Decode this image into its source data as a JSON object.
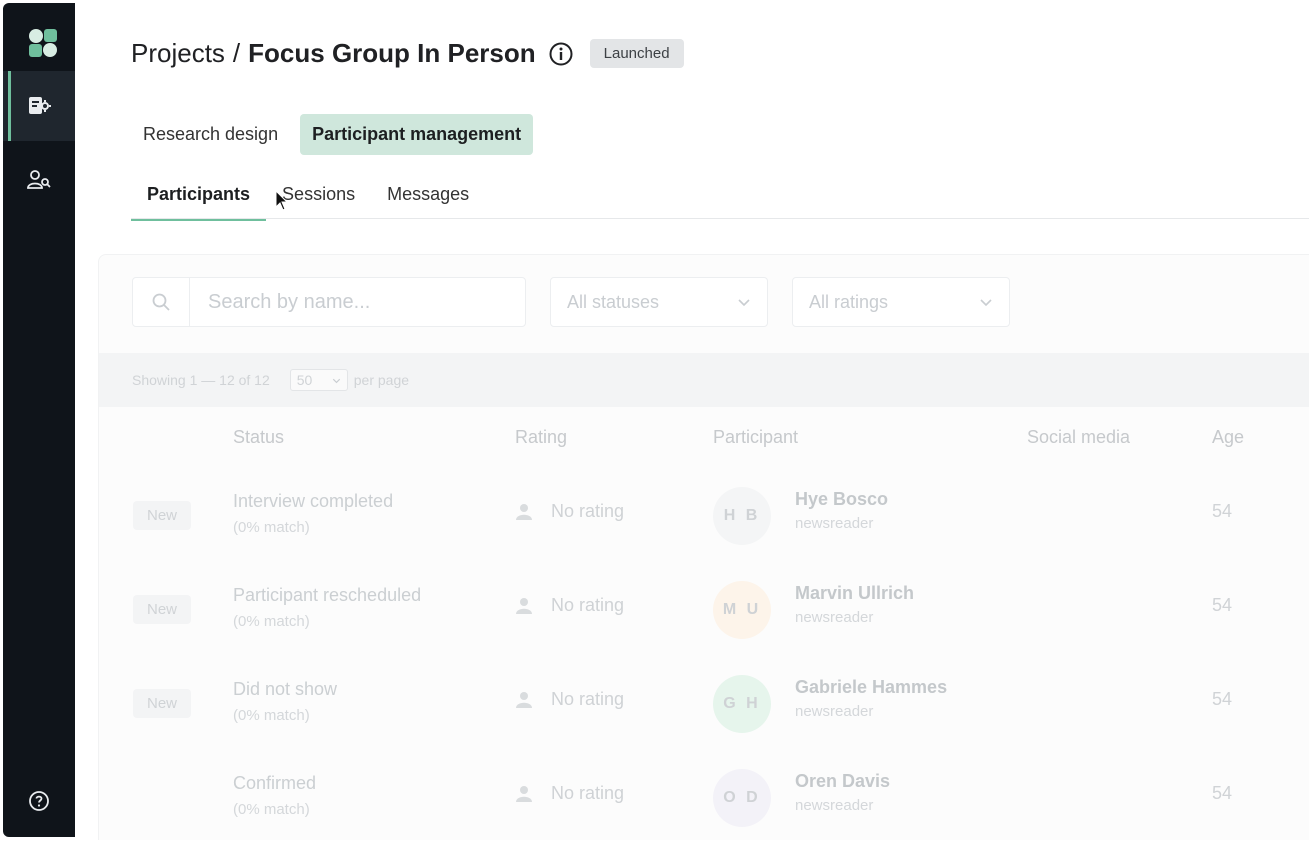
{
  "breadcrumb": {
    "root": "Projects",
    "separator": "/",
    "current": "Focus Group In Person"
  },
  "status_badge": "Launched",
  "mode_tabs": [
    {
      "label": "Research design",
      "active": false
    },
    {
      "label": "Participant management",
      "active": true
    }
  ],
  "sub_tabs": [
    {
      "label": "Participants",
      "active": true
    },
    {
      "label": "Sessions",
      "active": false
    },
    {
      "label": "Messages",
      "active": false
    }
  ],
  "search": {
    "placeholder": "Search by name..."
  },
  "filters": {
    "status": "All statuses",
    "rating": "All ratings"
  },
  "pagination": {
    "showing": "Showing 1 — 12 of 12",
    "per_page_value": "50",
    "per_page_label": "per page"
  },
  "table": {
    "headers": {
      "status": "Status",
      "rating": "Rating",
      "participant": "Participant",
      "social": "Social media",
      "age": "Age"
    },
    "rows": [
      {
        "tag": "New",
        "status": "Interview completed",
        "match": "(0% match)",
        "rating": "No rating",
        "initials": "H B",
        "name": "Hye Bosco",
        "sub": "newsreader",
        "age": "54",
        "avatar_color": "#f4f5f6"
      },
      {
        "tag": "New",
        "status": "Participant rescheduled",
        "match": "(0% match)",
        "rating": "No rating",
        "initials": "M U",
        "name": "Marvin Ullrich",
        "sub": "newsreader",
        "age": "54",
        "avatar_color": "#fdf4ea"
      },
      {
        "tag": "New",
        "status": "Did not show",
        "match": "(0% match)",
        "rating": "No rating",
        "initials": "G H",
        "name": "Gabriele Hammes",
        "sub": "newsreader",
        "age": "54",
        "avatar_color": "#e6f5ec"
      },
      {
        "tag": "",
        "status": "Confirmed",
        "match": "(0% match)",
        "rating": "No rating",
        "initials": "O D",
        "name": "Oren Davis",
        "sub": "newsreader",
        "age": "54",
        "avatar_color": "#f3f2f8"
      }
    ]
  },
  "colors": {
    "sidebar": "#0f141a",
    "accent": "#6fbf9d",
    "active_tab_bg": "#cfe7dc"
  },
  "icons": {
    "logo": "app-logo-icon",
    "research": "research-icon",
    "participants": "participants-icon",
    "help": "help-icon",
    "info": "info-icon",
    "search": "search-icon"
  }
}
